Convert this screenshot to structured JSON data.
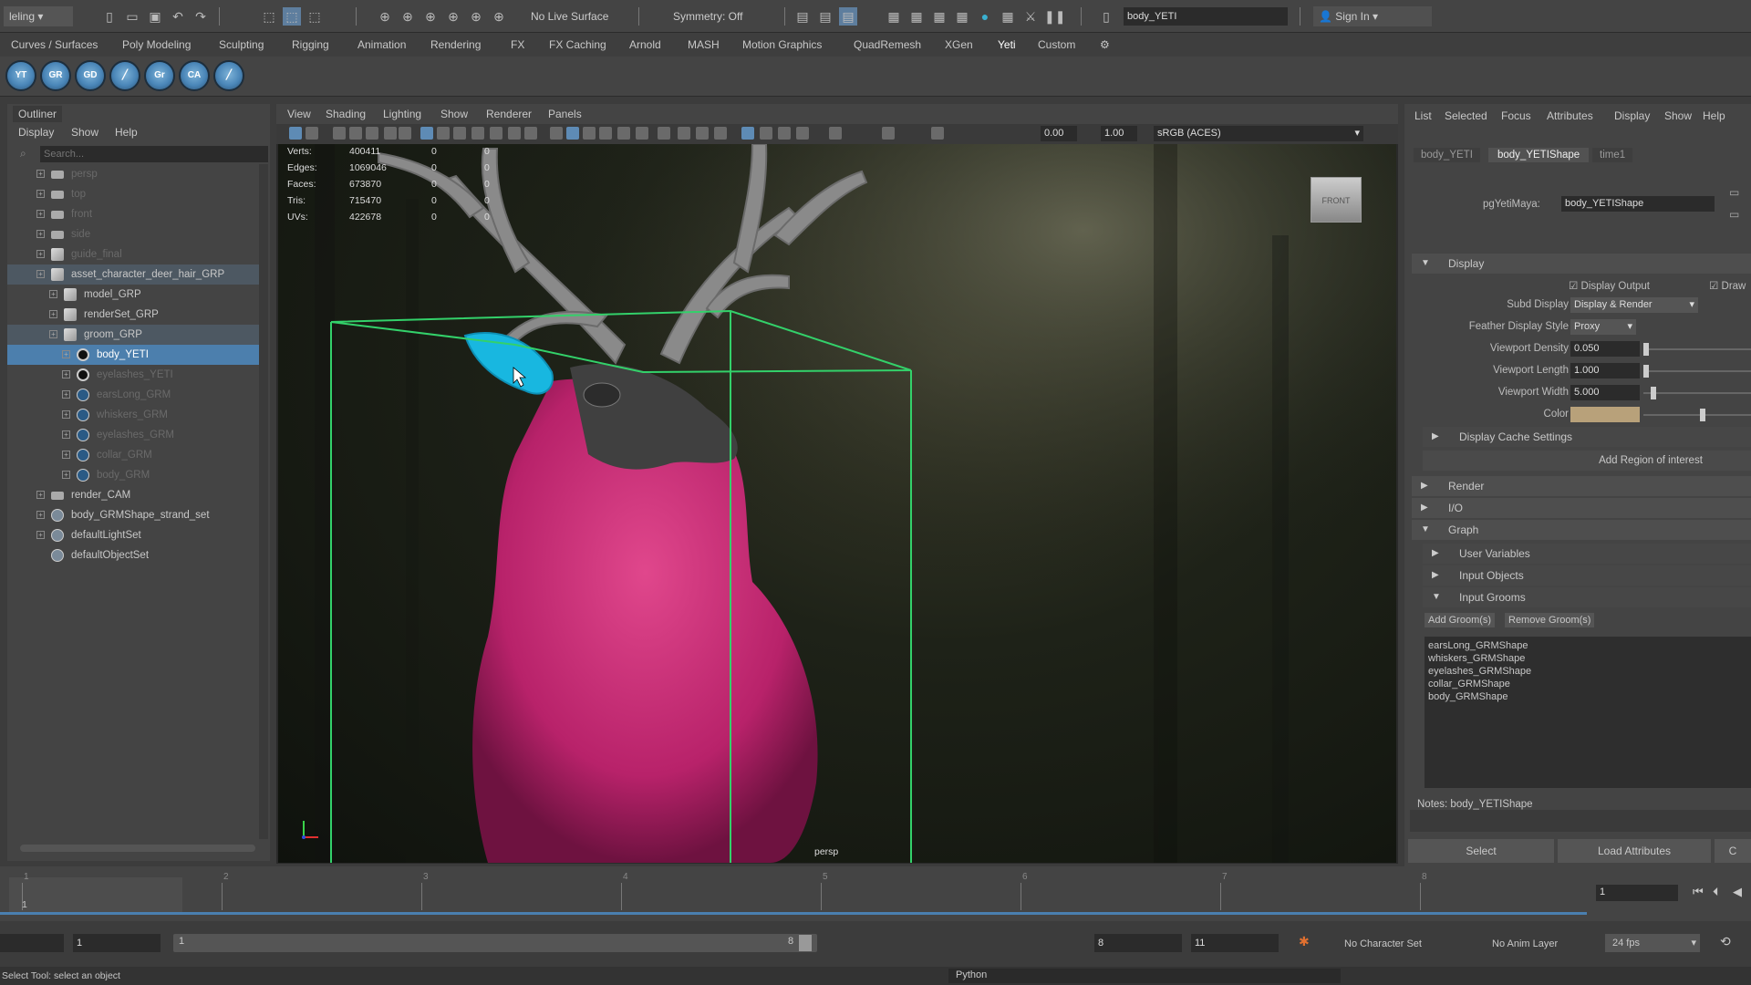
{
  "toolbar": {
    "menuset": "leling",
    "live_surface": "No Live Surface",
    "symmetry": "Symmetry: Off",
    "search_value": "body_YETI",
    "sign_in": "Sign In"
  },
  "shelf_tabs": [
    "Curves / Surfaces",
    "Poly Modeling",
    "Sculpting",
    "Rigging",
    "Animation",
    "Rendering",
    "FX",
    "FX Caching",
    "Arnold",
    "MASH",
    "Motion Graphics",
    "QuadRemesh",
    "XGen",
    "Yeti",
    "Custom"
  ],
  "outliner": {
    "title": "Outliner",
    "menu": [
      "Display",
      "Show",
      "Help"
    ],
    "search_placeholder": "Search...",
    "items": [
      {
        "label": "persp",
        "dim": true
      },
      {
        "label": "top",
        "dim": true
      },
      {
        "label": "front",
        "dim": true
      },
      {
        "label": "side",
        "dim": true
      },
      {
        "label": "guide_final",
        "dim": true
      },
      {
        "label": "asset_character_deer_hair_GRP",
        "dim": false
      },
      {
        "label": "model_GRP",
        "dim": false
      },
      {
        "label": "renderSet_GRP",
        "dim": false
      },
      {
        "label": "groom_GRP",
        "dim": false
      },
      {
        "label": "body_YETI",
        "dim": false
      },
      {
        "label": "eyelashes_YETI",
        "dim": true
      },
      {
        "label": "earsLong_GRM",
        "dim": true
      },
      {
        "label": "whiskers_GRM",
        "dim": true
      },
      {
        "label": "eyelashes_GRM",
        "dim": true
      },
      {
        "label": "collar_GRM",
        "dim": true
      },
      {
        "label": "body_GRM",
        "dim": true
      },
      {
        "label": "render_CAM",
        "dim": false
      },
      {
        "label": "body_GRMShape_strand_set",
        "dim": false
      },
      {
        "label": "defaultLightSet",
        "dim": false
      },
      {
        "label": "defaultObjectSet",
        "dim": false
      }
    ]
  },
  "viewport": {
    "menu": [
      "View",
      "Shading",
      "Lighting",
      "Show",
      "Renderer",
      "Panels"
    ],
    "near_clip": "0.00",
    "far_clip": "1.00",
    "color_space": "sRGB (ACES)",
    "hud": [
      {
        "label": "Verts:",
        "value": "400411",
        "a": "0",
        "b": "0"
      },
      {
        "label": "Edges:",
        "value": "1069046",
        "a": "0",
        "b": "0"
      },
      {
        "label": "Faces:",
        "value": "673870",
        "a": "0",
        "b": "0"
      },
      {
        "label": "Tris:",
        "value": "715470",
        "a": "0",
        "b": "0"
      },
      {
        "label": "UVs:",
        "value": "422678",
        "a": "0",
        "b": "0"
      }
    ],
    "camera": "persp",
    "viewcube": "FRONT"
  },
  "attr": {
    "menu": [
      "List",
      "Selected",
      "Focus",
      "Attributes",
      "Display",
      "Show",
      "Help"
    ],
    "tabs": [
      "body_YETI",
      "body_YETIShape",
      "time1"
    ],
    "node_label": "pgYetiMaya:",
    "node_value": "body_YETIShape",
    "display_section": "Display",
    "display_output": "Display Output",
    "draw_label": "Draw",
    "subd_display_label": "Subd Display",
    "subd_display_value": "Display & Render",
    "feather_label": "Feather Display Style",
    "feather_value": "Proxy",
    "density_label": "Viewport Density",
    "density_value": "0.050",
    "length_label": "Viewport Length",
    "length_value": "1.000",
    "width_label": "Viewport Width",
    "width_value": "5.000",
    "color_label": "Color",
    "cache_settings": "Display Cache Settings",
    "add_roi": "Add Region of interest",
    "render": "Render",
    "io": "I/O",
    "graph": "Graph",
    "user_vars": "User Variables",
    "input_objects": "Input Objects",
    "input_grooms": "Input Grooms",
    "add_groom": "Add Groom(s)",
    "remove_groom": "Remove Groom(s)",
    "grooms": [
      "earsLong_GRMShape",
      "whiskers_GRMShape",
      "eyelashes_GRMShape",
      "collar_GRMShape",
      "body_GRMShape"
    ],
    "notes": "Notes: body_YETIShape",
    "select": "Select",
    "load_attrs": "Load Attributes",
    "copy_tab": "C"
  },
  "timeline": {
    "ticks": [
      "1",
      "2",
      "3",
      "4",
      "5",
      "6",
      "7",
      "8"
    ],
    "current_frame": "1",
    "frame_field": "1"
  },
  "range": {
    "start": "1",
    "inner_start": "1",
    "inner_end": "8",
    "end": "8",
    "end2": "11",
    "char_set": "No Character Set",
    "anim_layer": "No Anim Layer",
    "fps": "24 fps"
  },
  "status": {
    "help": "Select Tool: select an object",
    "lang": "Python"
  },
  "colors": {
    "selection": "#4c7fad",
    "bbox": "#33d16a",
    "fur": "#d6307a",
    "ear": "#18b7e0"
  }
}
